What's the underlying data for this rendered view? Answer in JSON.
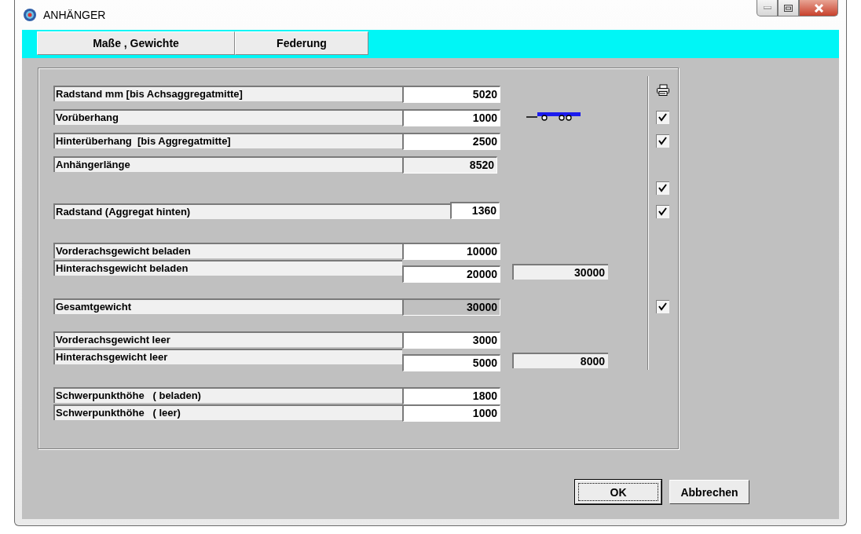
{
  "window": {
    "title": "ANHÄNGER"
  },
  "tabs": [
    {
      "label": "Maße , Gewichte"
    },
    {
      "label": "Federung"
    }
  ],
  "groups": [
    [
      {
        "kind": "field",
        "label": "Radstand mm [bis Achsaggregatmitte]",
        "value": {
          "kind": "input",
          "text": "5020"
        },
        "side": {
          "kind": "print"
        }
      },
      {
        "kind": "field",
        "label": "Vorüberhang",
        "value": {
          "kind": "input",
          "text": "1000"
        },
        "picture": {
          "kind": "trailer"
        },
        "side": {
          "kind": "checkbox",
          "checked": true
        }
      },
      {
        "kind": "field",
        "label": "Hinterüberhang  [bis Aggregatmitte]",
        "value": {
          "kind": "input",
          "text": "2500"
        },
        "side": {
          "kind": "checkbox",
          "checked": true
        }
      },
      {
        "kind": "field",
        "label": "Anhängerlänge",
        "value": {
          "kind": "readonly",
          "text": "8520"
        }
      },
      {
        "kind": "blank",
        "side": {
          "kind": "checkbox",
          "checked": true
        }
      },
      {
        "kind": "short",
        "label": "Radstand (Aggregat hinten)",
        "value": {
          "kind": "input",
          "text": "1360"
        },
        "side": {
          "kind": "checkbox",
          "checked": true
        }
      }
    ],
    [
      {
        "kind": "field",
        "label": "Vorderachsgewicht beladen",
        "value": {
          "kind": "input",
          "text": "10000"
        }
      },
      {
        "kind": "stacked",
        "label": "Hinterachsgewicht beladen",
        "value": {
          "kind": "input",
          "text": "20000"
        },
        "sum": "30000"
      }
    ],
    [
      {
        "kind": "field",
        "label": "Gesamtgewicht",
        "value": {
          "kind": "computed",
          "text": "30000"
        },
        "side": {
          "kind": "checkbox",
          "checked": true
        }
      }
    ],
    [
      {
        "kind": "field",
        "label": "Vorderachsgewicht leer",
        "value": {
          "kind": "input",
          "text": "3000"
        }
      },
      {
        "kind": "stacked",
        "label": "Hinterachsgewicht leer",
        "value": {
          "kind": "input",
          "text": "5000"
        },
        "sum": "8000"
      }
    ],
    [
      {
        "kind": "field",
        "label": "Schwerpunkthöhe   ( beladen)",
        "value": {
          "kind": "input",
          "text": "1800"
        }
      },
      {
        "kind": "field",
        "label": "Schwerpunkthöhe   ( leer)",
        "value": {
          "kind": "input",
          "text": "1000"
        }
      }
    ]
  ],
  "buttons": [
    {
      "label": "OK",
      "focused": true
    },
    {
      "label": "Abbrechen",
      "focused": false
    }
  ]
}
